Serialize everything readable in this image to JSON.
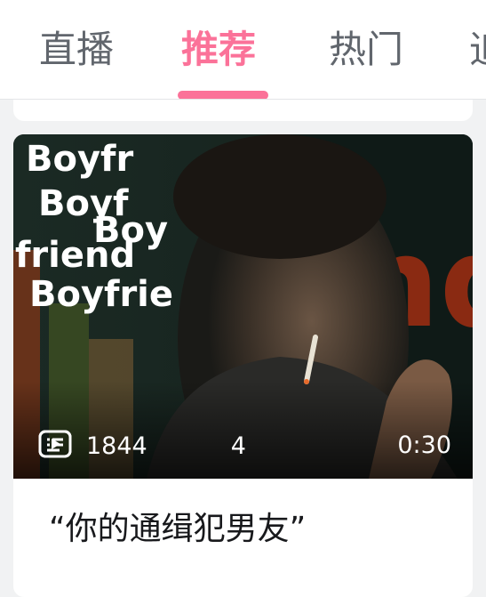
{
  "tabs": [
    {
      "label": "直播",
      "active": false
    },
    {
      "label": "推荐",
      "active": true
    },
    {
      "label": "热门",
      "active": false
    },
    {
      "label": "追",
      "active": false
    }
  ],
  "colors": {
    "accent": "#fb7299",
    "tab_inactive": "#61666d",
    "background": "#f1f2f3",
    "card": "#ffffff"
  },
  "video_card": {
    "cover_text": {
      "line1": "Boyfr",
      "line2": "Boyf",
      "line3": "Boy",
      "line4": "friend",
      "line5": "Boyfrie",
      "bg_text": "nd"
    },
    "play_icon": "play-count-icon",
    "play_count": "1844",
    "danmaku_icon": "danmaku-icon",
    "danmaku_count": "4",
    "duration": "0:30",
    "title": "“你的通缉犯男友”"
  }
}
